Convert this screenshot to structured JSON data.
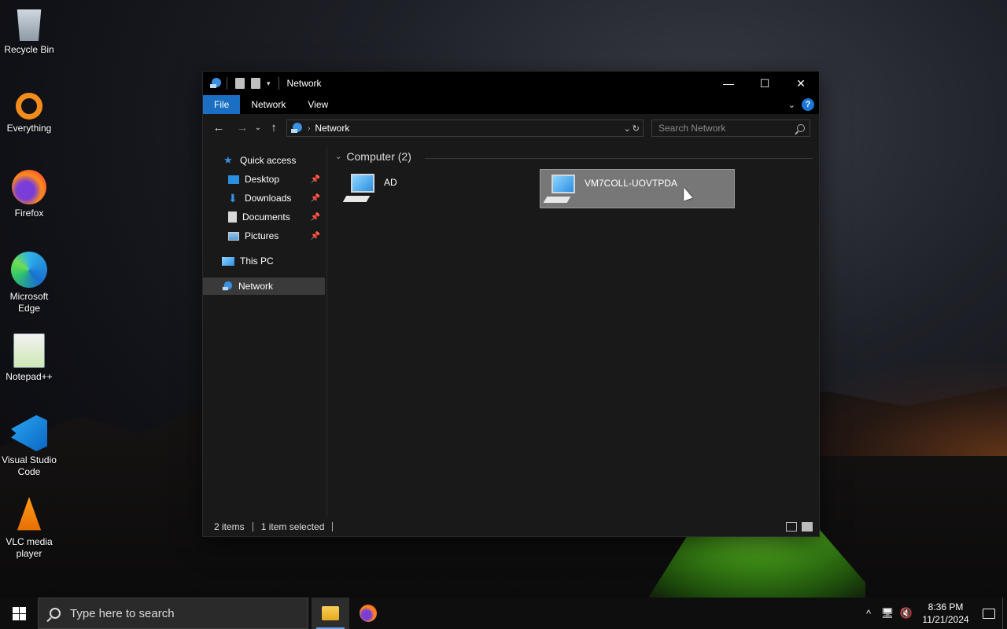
{
  "desktop": {
    "icons": [
      {
        "label": "Recycle Bin",
        "icon": "recycle-bin-icon"
      },
      {
        "label": "Everything",
        "icon": "everything-icon"
      },
      {
        "label": "Firefox",
        "icon": "firefox-icon"
      },
      {
        "label": "Microsoft Edge",
        "icon": "edge-icon"
      },
      {
        "label": "Notepad++",
        "icon": "notepad-plus-plus-icon"
      },
      {
        "label": "Visual Studio Code",
        "icon": "vscode-icon"
      },
      {
        "label": "VLC media player",
        "icon": "vlc-icon"
      }
    ]
  },
  "window": {
    "title": "Network",
    "ribbon_tabs": [
      "File",
      "Network",
      "View"
    ],
    "address": {
      "path": "Network"
    },
    "search": {
      "placeholder": "Search Network"
    },
    "nav_pane": {
      "quick_access": "Quick access",
      "items": [
        {
          "label": "Desktop",
          "pinned": true
        },
        {
          "label": "Downloads",
          "pinned": true
        },
        {
          "label": "Documents",
          "pinned": true
        },
        {
          "label": "Pictures",
          "pinned": true
        }
      ],
      "this_pc": "This PC",
      "network": "Network"
    },
    "content": {
      "group_label": "Computer (2)",
      "computers": [
        {
          "name": "AD",
          "selected": false
        },
        {
          "name": "VM7COLL-UOVTPDA",
          "selected": true
        }
      ]
    },
    "status": {
      "items_count": "2 items",
      "selection": "1 item selected"
    }
  },
  "taskbar": {
    "search_placeholder": "Type here to search",
    "clock_time": "8:36 PM",
    "clock_date": "11/21/2024"
  },
  "colors": {
    "accent": "#1a6fc2",
    "window_bg": "#191919",
    "selected_tile": "#777777"
  }
}
